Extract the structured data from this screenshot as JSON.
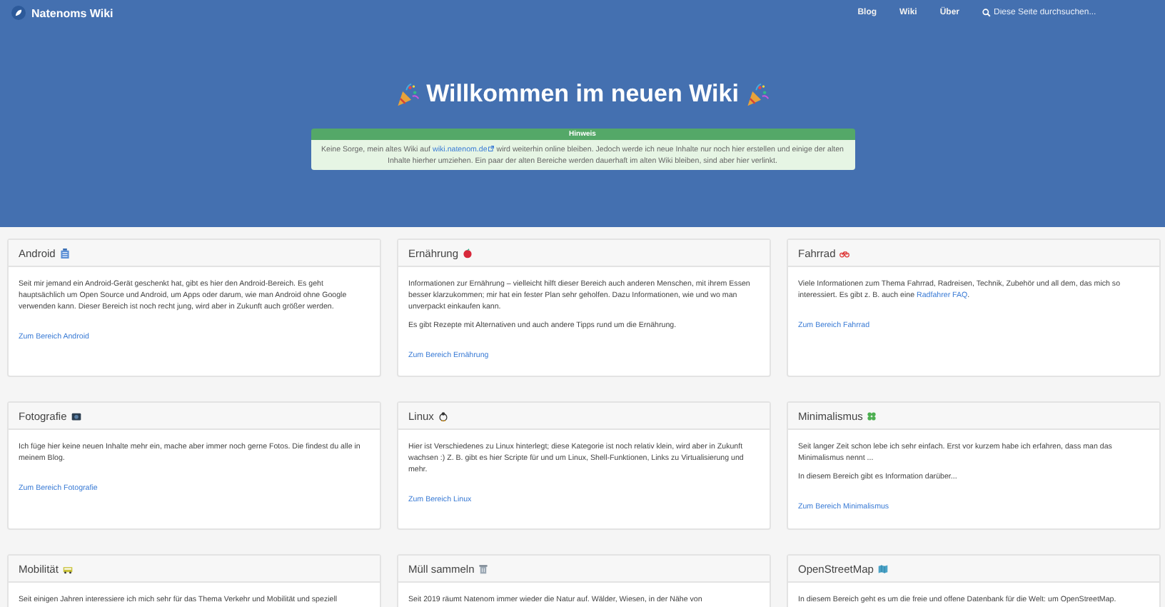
{
  "navbar": {
    "brand": "Natenoms Wiki",
    "links": [
      {
        "label": "Blog"
      },
      {
        "label": "Wiki"
      },
      {
        "label": "Über"
      }
    ],
    "search": {
      "placeholder": "Diese Seite durchsuchen..."
    }
  },
  "hero": {
    "title": "Willkommen im neuen Wiki",
    "notice": {
      "heading": "Hinweis",
      "parts": [
        {
          "kind": "text",
          "text": "Keine Sorge, mein altes Wiki auf"
        },
        {
          "kind": "link",
          "text": "wiki.natenom.de"
        },
        {
          "kind": "text",
          "text": "wird weiterhin online bleiben. Jedoch werde ich neue Inhalte nur noch hier erstellen und einige der alten Inhalte hierher umziehen. Ein paar der alten Bereiche werden dauerhaft im alten Wiki bleiben, sind aber hier verlinkt."
        }
      ]
    }
  },
  "cards": [
    {
      "title": "Android",
      "paragraphs": [
        [
          {
            "kind": "text",
            "text": "Seit mir jemand ein Android-Gerät geschenkt hat, gibt es hier den Android-Bereich. Es geht hauptsächlich um Open Source und Android, um Apps oder darum, wie man Android ohne Google verwenden kann. Dieser Bereich ist noch recht jung, wird aber in Zukunft auch größer werden."
          }
        ]
      ],
      "link": "Zum Bereich Android"
    },
    {
      "title": "Ernährung",
      "paragraphs": [
        [
          {
            "kind": "text",
            "text": "Informationen zur Ernährung – vielleicht hilft dieser Bereich auch anderen Menschen, mit ihrem Essen besser klarzukommen; mir hat ein fester Plan sehr geholfen. Dazu Informationen, wie und wo man unverpackt einkaufen kann."
          }
        ],
        [
          {
            "kind": "text",
            "text": "Es gibt Rezepte mit Alternativen und auch andere Tipps rund um die Ernährung."
          }
        ]
      ],
      "link": "Zum Bereich Ernährung"
    },
    {
      "title": "Fahrrad",
      "paragraphs": [
        [
          {
            "kind": "text",
            "text": "Viele Informationen zum Thema Fahrrad, Radreisen, Technik, Zubehör und all dem, das mich so interessiert. Es gibt z. B. auch eine"
          },
          {
            "kind": "link",
            "text": "Radfahrer FAQ"
          },
          {
            "kind": "text",
            "text": "."
          }
        ]
      ],
      "link": "Zum Bereich Fahrrad"
    },
    {
      "title": "Fotografie",
      "paragraphs": [
        [
          {
            "kind": "text",
            "text": "Ich füge hier keine neuen Inhalte mehr ein, mache aber immer noch gerne Fotos. Die findest du alle in meinem Blog."
          }
        ]
      ],
      "link": "Zum Bereich Fotografie"
    },
    {
      "title": "Linux",
      "paragraphs": [
        [
          {
            "kind": "text",
            "text": "Hier ist Verschiedenes zu Linux hinterlegt; diese Kategorie ist noch relativ klein, wird aber in Zukunft wachsen :) Z. B. gibt es hier Scripte für und um Linux, Shell-Funktionen, Links zu Virtualisierung und mehr."
          }
        ]
      ],
      "link": "Zum Bereich Linux"
    },
    {
      "title": "Minimalismus",
      "paragraphs": [
        [
          {
            "kind": "text",
            "text": "Seit langer Zeit schon lebe ich sehr einfach. Erst vor kurzem habe ich erfahren, dass man das Minimalismus nennt ..."
          }
        ],
        [
          {
            "kind": "text",
            "text": "In diesem Bereich gibt es Information darüber..."
          }
        ]
      ],
      "link": "Zum Bereich Minimalismus"
    },
    {
      "title": "Mobilität",
      "paragraphs": [
        [
          {
            "kind": "text",
            "text": "Seit einigen Jahren interessiere ich mich sehr für das Thema Verkehr und Mobilität und speziell"
          }
        ]
      ]
    },
    {
      "title": "Müll sammeln",
      "paragraphs": [
        [
          {
            "kind": "text",
            "text": "Seit 2019 räumt Natenom immer wieder die Natur auf. Wälder, Wiesen, in der Nähe von"
          }
        ]
      ]
    },
    {
      "title": "OpenStreetMap",
      "paragraphs": [
        [
          {
            "kind": "text",
            "text": "In diesem Bereich geht es um die freie und offene Datenbank für die Welt: um OpenStreetMap."
          }
        ]
      ]
    }
  ]
}
